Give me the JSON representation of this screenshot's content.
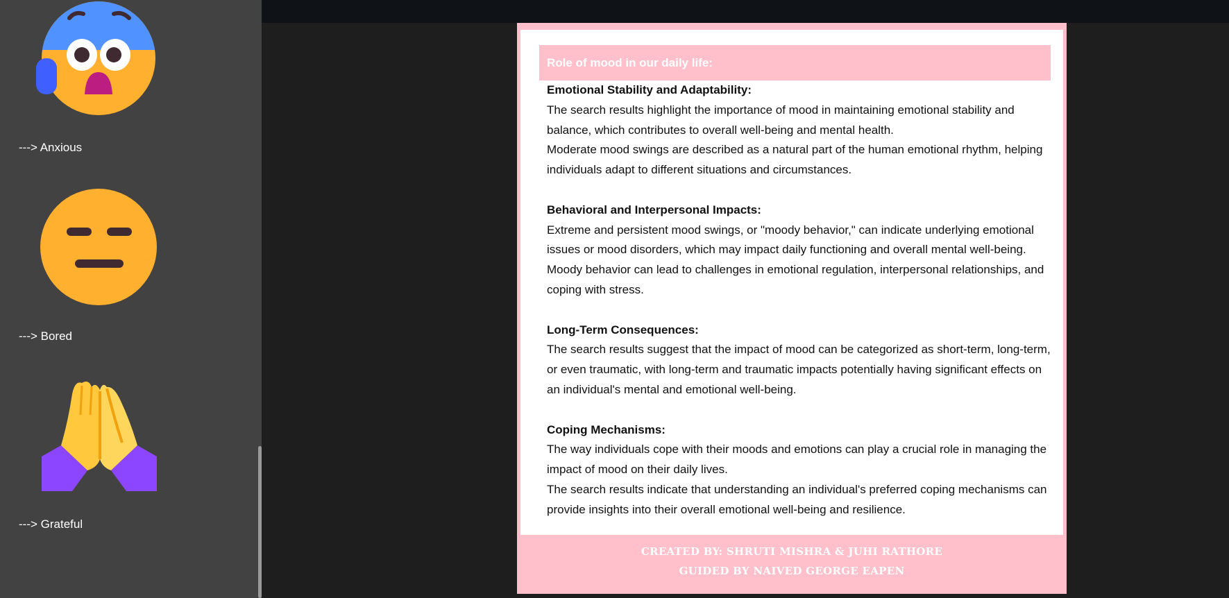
{
  "sidebar": {
    "items": [
      {
        "label": "---> Anxious",
        "icon": "anxious-sweat-face-icon"
      },
      {
        "label": "---> Bored",
        "icon": "expressionless-face-icon"
      },
      {
        "label": "---> Grateful",
        "icon": "folded-hands-icon"
      }
    ]
  },
  "article": {
    "heading": "Role of mood in our daily life:",
    "sections": [
      {
        "title": "Emotional Stability and Adaptability:",
        "paragraphs": [
          "The search results highlight the importance of mood in maintaining emotional stability and balance, which contributes to overall well-being and mental health.",
          "Moderate mood swings are described as a natural part of the human emotional rhythm, helping individuals adapt to different situations and circumstances."
        ]
      },
      {
        "title": "Behavioral and Interpersonal Impacts:",
        "paragraphs": [
          "Extreme and persistent mood swings, or \"moody behavior,\" can indicate underlying emotional issues or mood disorders, which may impact daily functioning and overall mental well-being.",
          "Moody behavior can lead to challenges in emotional regulation, interpersonal relationships, and coping with stress."
        ]
      },
      {
        "title": "Long-Term Consequences:",
        "paragraphs": [
          "The search results suggest that the impact of mood can be categorized as short-term, long-term, or even traumatic, with long-term and traumatic impacts potentially having significant effects on an individual's mental and emotional well-being."
        ]
      },
      {
        "title": "Coping Mechanisms:",
        "paragraphs": [
          "The way individuals cope with their moods and emotions can play a crucial role in managing the impact of mood on their daily lives.",
          "The search results indicate that understanding an individual's preferred coping mechanisms can provide insights into their overall emotional well-being and resilience."
        ]
      }
    ]
  },
  "footer": {
    "created_by": "Created by: Shruti Mishra & Juhi Rathore",
    "guided_by": "Guided by Naived George Eapen"
  },
  "colors": {
    "accent_pink": "#ffc0cb",
    "sidebar_bg": "#424242",
    "main_bg": "#1e1e1e",
    "topbar_bg": "#0f1217"
  }
}
